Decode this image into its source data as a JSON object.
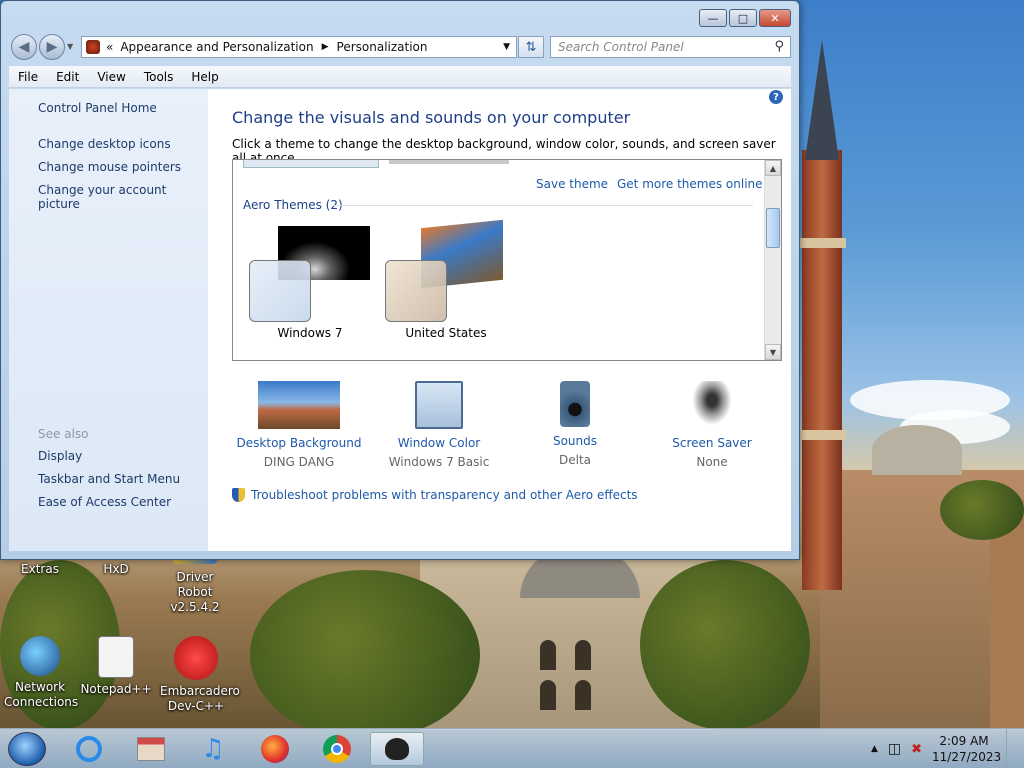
{
  "window": {
    "address_breadcrumb": [
      "Appearance and Personalization",
      "Personalization"
    ],
    "search_placeholder": "Search Control Panel",
    "menu": [
      "File",
      "Edit",
      "View",
      "Tools",
      "Help"
    ]
  },
  "left_pane": {
    "home": "Control Panel Home",
    "links": [
      "Change desktop icons",
      "Change mouse pointers",
      "Change your account picture"
    ],
    "see_also_heading": "See also",
    "see_also": [
      "Display",
      "Taskbar and Start Menu",
      "Ease of Access Center"
    ]
  },
  "main": {
    "title": "Change the visuals and sounds on your computer",
    "subtitle": "Click a theme to change the desktop background, window color, sounds, and screen saver all at once.",
    "save_theme": "Save theme",
    "get_more": "Get more themes online",
    "group_label": "Aero Themes (2)",
    "themes": [
      "Windows 7",
      "United States"
    ],
    "settings": [
      {
        "label": "Desktop Background",
        "value": "DING DANG"
      },
      {
        "label": "Window Color",
        "value": "Windows 7 Basic"
      },
      {
        "label": "Sounds",
        "value": "Delta"
      },
      {
        "label": "Screen Saver",
        "value": "None"
      }
    ],
    "troubleshoot": "Troubleshoot problems with transparency and other Aero effects"
  },
  "desktop_icons": [
    {
      "label": "Extras"
    },
    {
      "label": "HxD"
    },
    {
      "label": "Driver Robot v2.5.4.2"
    },
    {
      "label": "Network Connections"
    },
    {
      "label": "Notepad++"
    },
    {
      "label": "Embarcadero Dev-C++"
    }
  ],
  "taskbar": {
    "apps": [
      "internet-explorer-icon",
      "store-icon",
      "music-icon",
      "firefox-icon",
      "chrome-icon",
      "paint-brush-icon"
    ],
    "time": "2:09 AM",
    "date": "11/27/2023"
  },
  "colors": {
    "link": "#1e5aa8",
    "title": "#1e3e8a"
  }
}
